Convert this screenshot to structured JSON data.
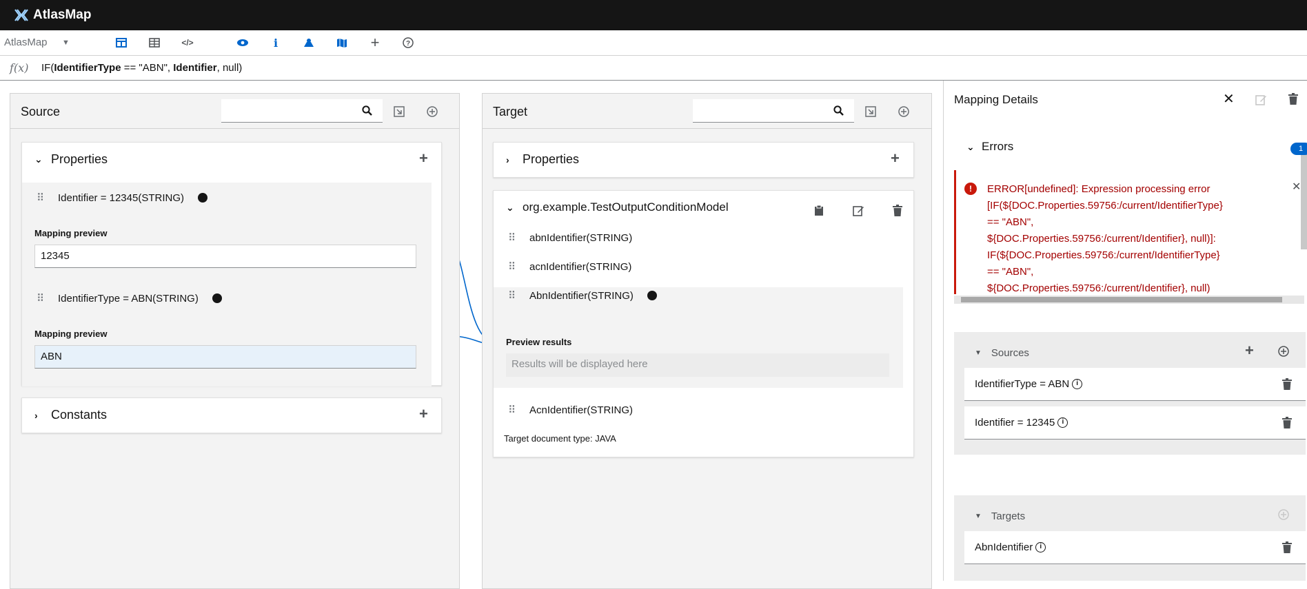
{
  "app": {
    "title": "AtlasMap",
    "selector_label": "AtlasMap"
  },
  "toolbar_icons": [
    "columns-icon",
    "table-icon",
    "code-icon",
    "eye-icon",
    "info-icon",
    "map-marked-icon",
    "map-icon",
    "plus-icon",
    "help-icon"
  ],
  "expression": {
    "fx_label": "f(x)",
    "parts": {
      "p1": "IF(",
      "p2": "IdentifierType",
      "p3": " == \"ABN\", ",
      "p4": "Identifier",
      "p5": ", null)"
    }
  },
  "source": {
    "title": "Source",
    "search_placeholder": "",
    "properties": {
      "title": "Properties",
      "fields": [
        {
          "label": "Identifier = 12345(STRING)",
          "preview_label": "Mapping preview",
          "preview_value": "12345"
        },
        {
          "label": "IdentifierType = ABN(STRING)",
          "preview_label": "Mapping preview",
          "preview_value": "ABN"
        }
      ]
    },
    "constants": {
      "title": "Constants"
    }
  },
  "target": {
    "title": "Target",
    "search_placeholder": "",
    "properties": {
      "title": "Properties"
    },
    "model": {
      "title": "org.example.TestOutputConditionModel",
      "fields": [
        {
          "label": "abnIdentifier(STRING)"
        },
        {
          "label": "acnIdentifier(STRING)"
        },
        {
          "label": "AbnIdentifier(STRING)"
        },
        {
          "label": "AcnIdentifier(STRING)"
        }
      ],
      "preview_label": "Preview results",
      "preview_placeholder": "Results will be displayed here",
      "doc_type": "Target document type: JAVA"
    }
  },
  "details": {
    "title": "Mapping Details",
    "errors": {
      "title": "Errors",
      "count": "1",
      "lines": [
        "ERROR[undefined]: Expression processing error",
        "[IF(${DOC.Properties.59756:/current/IdentifierType}",
        "== \"ABN\",",
        "${DOC.Properties.59756:/current/Identifier}, null)]:",
        "IF(${DOC.Properties.59756:/current/IdentifierType}",
        "== \"ABN\",",
        "${DOC.Properties.59756:/current/Identifier}, null)"
      ]
    },
    "sources": {
      "title": "Sources",
      "items": [
        {
          "label": "IdentifierType = ABN"
        },
        {
          "label": "Identifier = 12345"
        }
      ]
    },
    "targets": {
      "title": "Targets",
      "items": [
        {
          "label": "AbnIdentifier"
        }
      ]
    }
  },
  "colors": {
    "accent": "#0066cc",
    "error": "#c9190b",
    "topbar": "#151515",
    "line": "#0066cc"
  }
}
